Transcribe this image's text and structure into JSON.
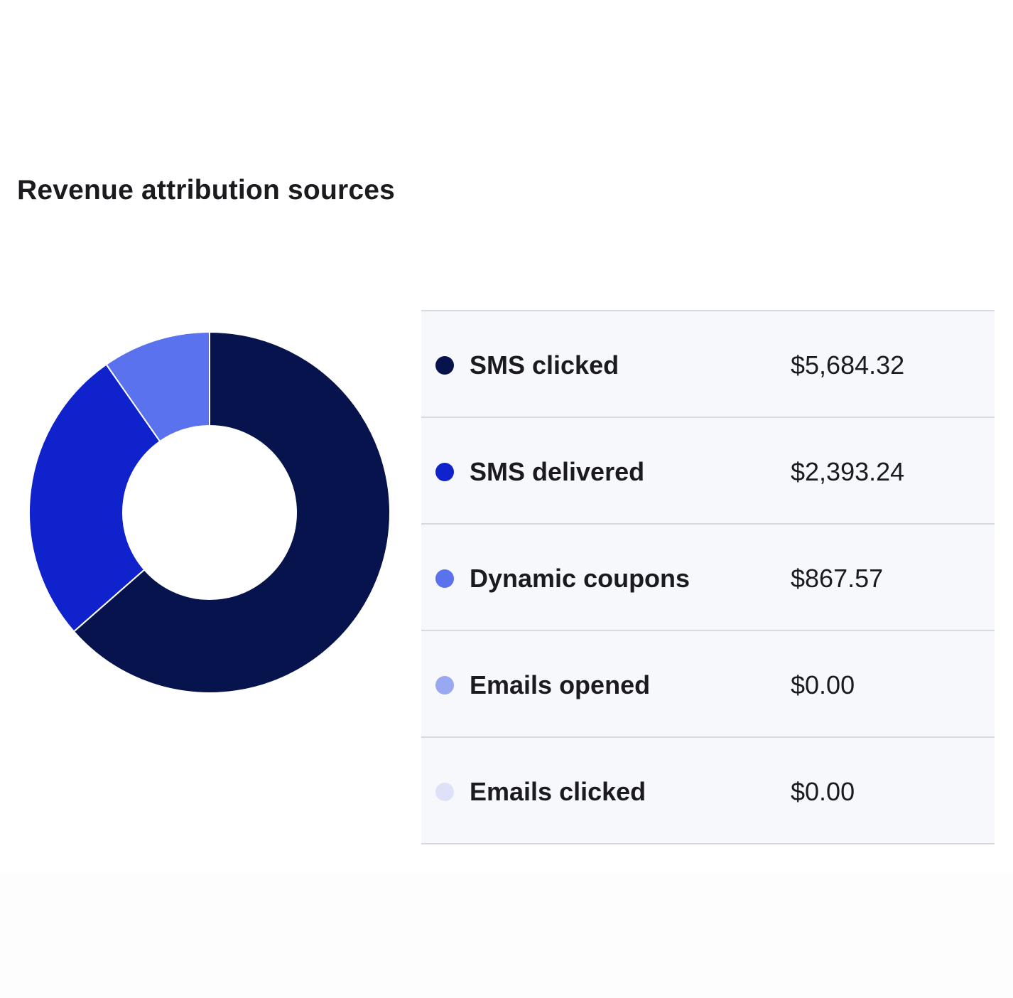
{
  "chart_data": {
    "type": "pie",
    "title": "Revenue attribution sources",
    "categories": [
      "SMS clicked",
      "SMS delivered",
      "Dynamic coupons",
      "Emails opened",
      "Emails clicked"
    ],
    "value_labels": [
      "$5,684.32",
      "$2,393.24",
      "$867.57",
      "$0.00",
      "$0.00"
    ],
    "values": [
      5684.32,
      2393.24,
      867.57,
      0,
      0
    ],
    "colors": [
      "#06134d",
      "#0f22cc",
      "#5a72ee",
      "#98a8f1",
      "#dde2f9"
    ],
    "donut": true,
    "legend": "right"
  }
}
